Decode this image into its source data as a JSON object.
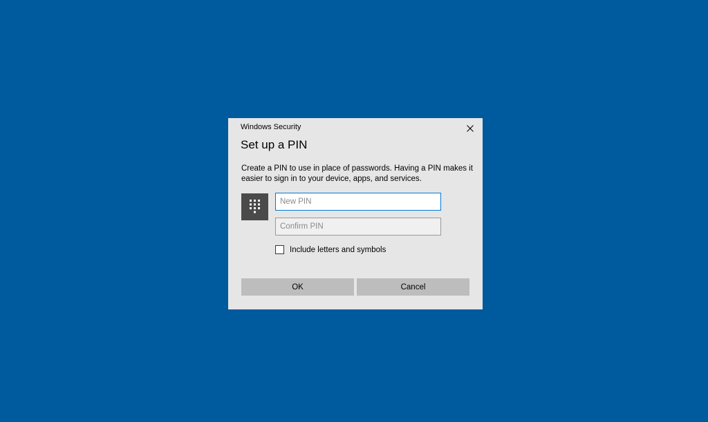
{
  "dialog": {
    "window_title": "Windows Security",
    "heading": "Set up a PIN",
    "description": "Create a PIN to use in place of passwords. Having a PIN makes it easier to sign in to your device, apps, and services.",
    "icons": {
      "close": "close-icon",
      "pin": "keypad-icon"
    },
    "new_pin": {
      "value": "",
      "placeholder": "New PIN"
    },
    "confirm_pin": {
      "value": "",
      "placeholder": "Confirm PIN"
    },
    "checkbox": {
      "label": "Include letters and symbols",
      "checked": false
    },
    "ok_label": "OK",
    "cancel_label": "Cancel"
  },
  "colors": {
    "desktop_background": "#005a9e",
    "dialog_background": "#e6e6e6",
    "focus_border": "#0078d7",
    "button_background": "#bdbdbd",
    "icon_tile": "#4a4a4a"
  }
}
